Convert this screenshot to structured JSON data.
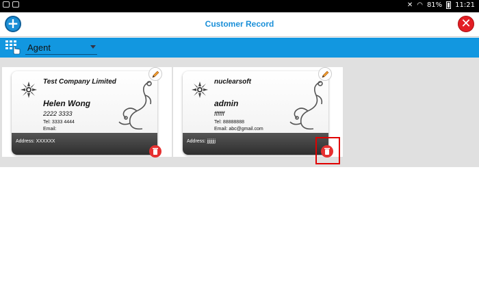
{
  "status_bar": {
    "battery": "81%",
    "time": "11:21"
  },
  "header": {
    "title": "Customer Record"
  },
  "filter": {
    "selected": "Agent"
  },
  "cards": [
    {
      "company": "Test Company Limited",
      "name": "Helen Wong",
      "phone": "2222 3333",
      "tel": "Tel: 3333 4444",
      "email": "Email:",
      "address": "Address: XXXXXX"
    },
    {
      "company": "nuclearsoft",
      "name": "admin",
      "phone": "ffffff",
      "tel": "Tel: 88888888",
      "email": "Email: abc@gmail.com",
      "address": "Address: jjjjjjjj"
    }
  ],
  "colors": {
    "accent": "#1297e0",
    "title": "#1a8fd8",
    "delete": "#e63030",
    "close": "#e31e24"
  }
}
